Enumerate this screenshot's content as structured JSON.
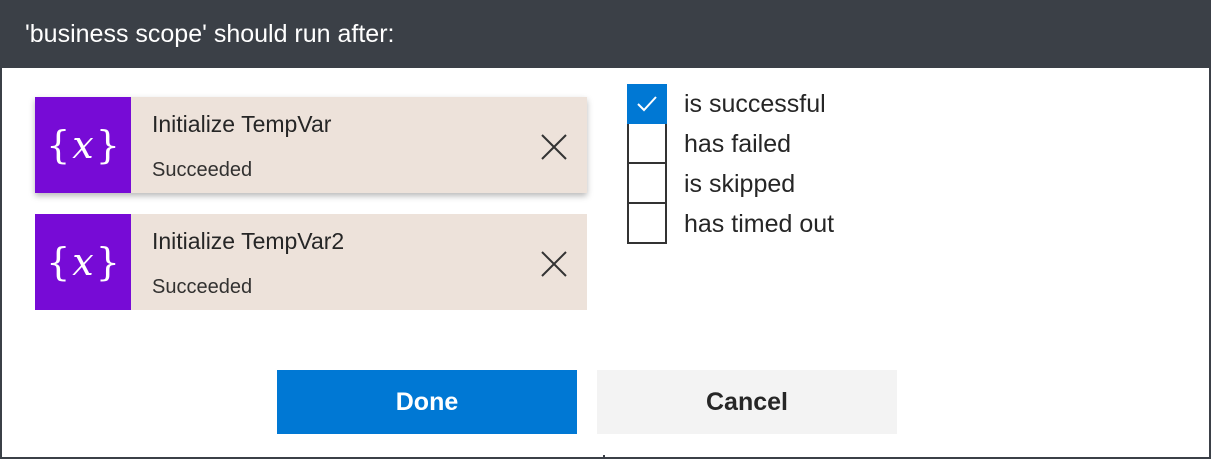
{
  "dialog": {
    "title": "'business scope' should run after:"
  },
  "actions": [
    {
      "name": "Initialize TempVar",
      "status": "Succeeded",
      "icon": "variable-icon"
    },
    {
      "name": "Initialize TempVar2",
      "status": "Succeeded",
      "icon": "variable-icon"
    }
  ],
  "conditions": [
    {
      "label": "is successful",
      "checked": true
    },
    {
      "label": "has failed",
      "checked": false
    },
    {
      "label": "is skipped",
      "checked": false
    },
    {
      "label": "has timed out",
      "checked": false
    }
  ],
  "buttons": {
    "done_label": "Done",
    "cancel_label": "Cancel"
  },
  "colors": {
    "title_bar": "#3b4047",
    "action_icon_bg": "#770bd6",
    "action_card_bg": "#ede2da",
    "accent": "#0078d4",
    "cancel_bg": "#f3f3f3"
  }
}
